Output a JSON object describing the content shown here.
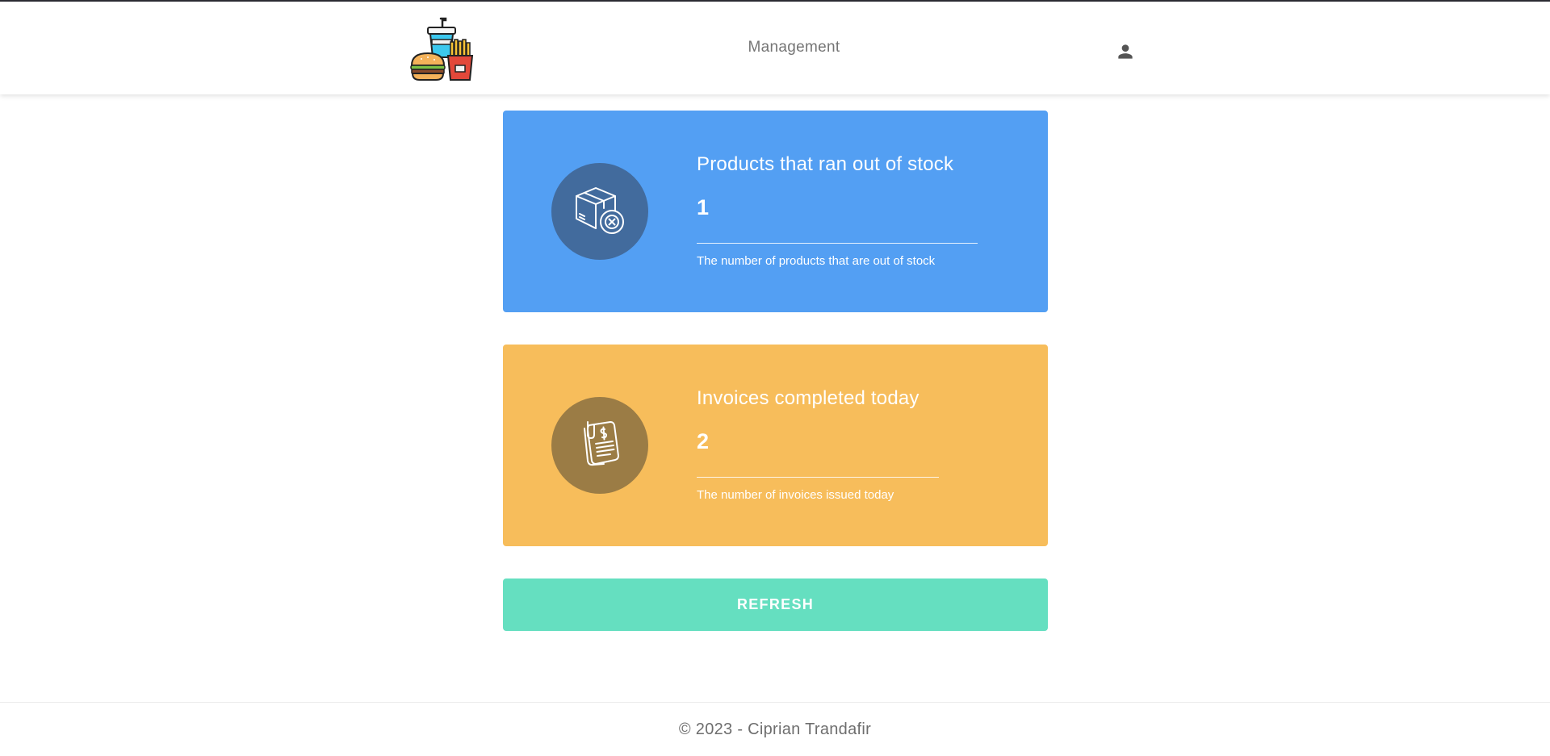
{
  "header": {
    "logo_icon": "fast-food-logo-icon",
    "nav_link": "Management",
    "user_icon": "person-icon"
  },
  "cards": [
    {
      "icon": "box-out-of-stock-icon",
      "title": "Products that ran out of stock",
      "count": "1",
      "description": "The number of products that are out of stock",
      "color": "#539ff3",
      "circle_color": "#426b9d"
    },
    {
      "icon": "invoice-dollar-icon",
      "title": "Invoices completed today",
      "count": "2",
      "description": "The number of invoices issued today",
      "color": "#f7bd5b",
      "circle_color": "#9b7c45"
    }
  ],
  "refresh_button": {
    "label": "REFRESH",
    "color": "#65dfc0"
  },
  "footer": {
    "text": "© 2023 - Ciprian Trandafir"
  }
}
